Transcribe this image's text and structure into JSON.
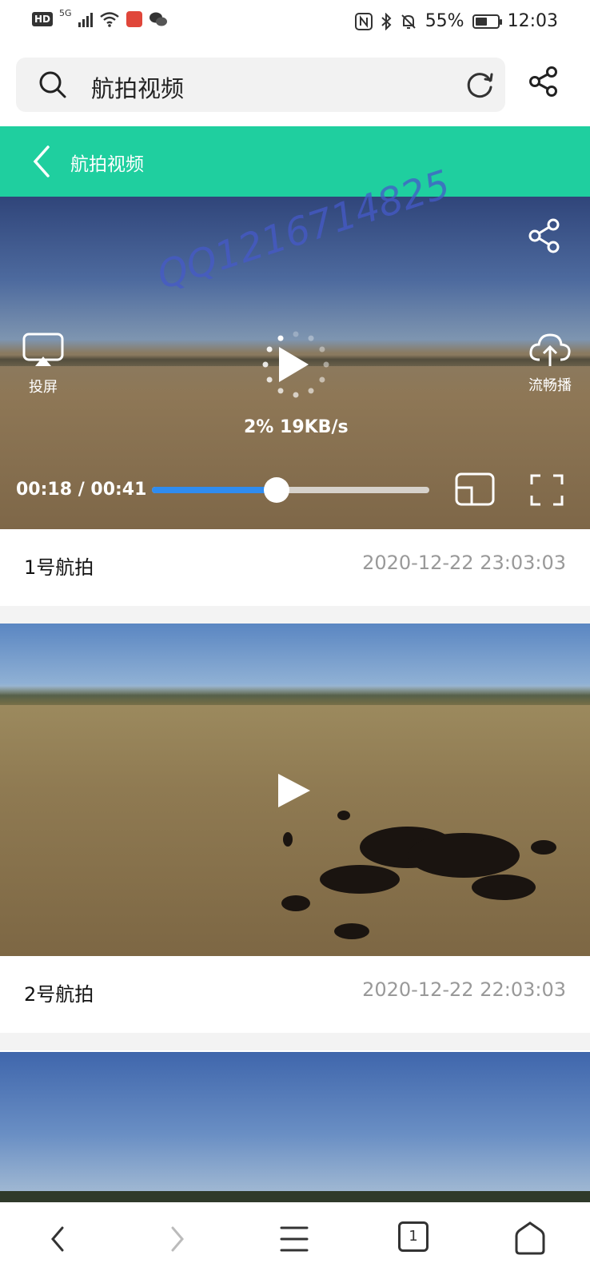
{
  "status_bar": {
    "hd": "HD",
    "network": "5G",
    "battery": "55%",
    "battery_level": 0.55,
    "time": "12:03"
  },
  "address_bar": {
    "text": "航拍视频",
    "search_icon": "search-icon",
    "reload_icon": "reload-icon"
  },
  "header": {
    "title": "航拍视频",
    "back_icon": "chevron-left-icon"
  },
  "player": {
    "watermark": "QQ1216714825",
    "cast_label": "投屏",
    "smooth_label": "流畅播",
    "loading_stats": "2%  19KB/s",
    "time": "00:18 / 00:41",
    "progress": 0.45,
    "accent": "#2f8cf0"
  },
  "videos": [
    {
      "name": "1号航拍",
      "date": "2020-12-22 23:03:03"
    },
    {
      "name": "2号航拍",
      "date": "2020-12-22 22:03:03"
    }
  ],
  "bottom_nav": {
    "tab_count": "1",
    "items": [
      "back-icon",
      "forward-icon",
      "menu-icon",
      "tabs-icon",
      "home-icon"
    ]
  },
  "colors": {
    "header_green": "#1fcf9f",
    "date_gray": "#999999"
  }
}
